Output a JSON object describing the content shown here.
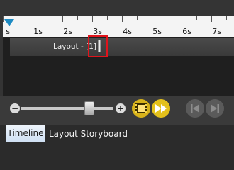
{
  "timeline": {
    "ruler_labels": [
      "s",
      "1s",
      "2s",
      "3s",
      "4s",
      "5s",
      "6s",
      "7s"
    ],
    "track_label": "Layout - [1]"
  },
  "controls": {
    "zoom_out_symbol": "−",
    "zoom_in_symbol": "+",
    "icons": [
      "zoom-out-icon",
      "zoom-slider",
      "zoom-in-icon",
      "filmstrip-icon",
      "play-forward-icon",
      "skip-back-icon",
      "skip-forward-icon"
    ]
  },
  "tabs": {
    "active": "Timeline",
    "inactive": "Layout Storyboard"
  },
  "colors": {
    "accent_yellow": "#e3c01b",
    "playhead_blue": "#1e8bc3",
    "highlight_red": "#e0141c",
    "keyframe": "#e8e8e8"
  }
}
